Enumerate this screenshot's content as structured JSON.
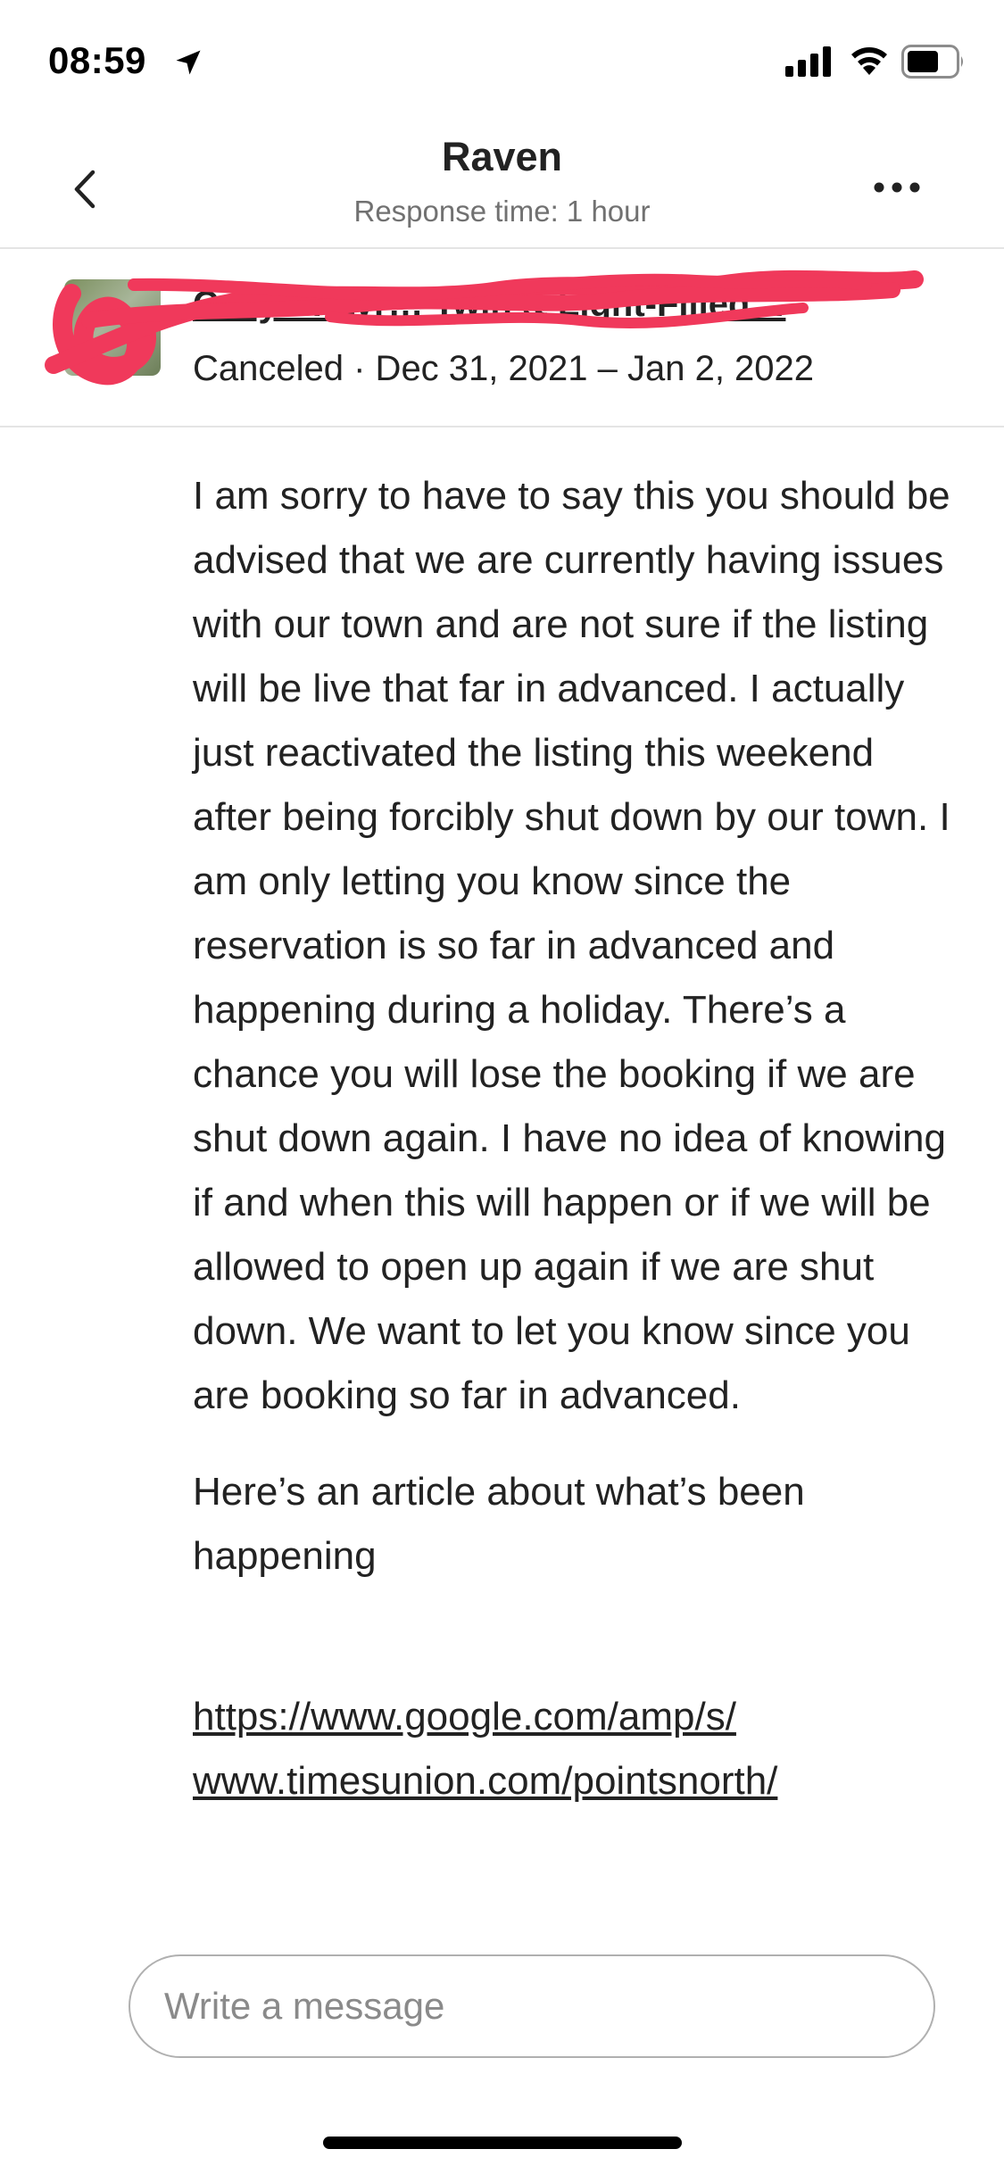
{
  "status_bar": {
    "time": "08:59"
  },
  "header": {
    "title": "Raven",
    "subtitle": "Response time: 1 hour"
  },
  "reservation": {
    "listing_title": "Cozy … Lyr… Twin & Light-Filled…",
    "status": "Canceled · Dec 31, 2021 – Jan 2, 2022"
  },
  "message": {
    "paragraphs": [
      "I am sorry to have to say this you should be advised that we are currently having issues with our town and are not sure if the listing will be live that far in advanced. I actually just reactivated the listing this weekend after being forcibly shut down by our town. I am only letting you know since the reservation is so far in advanced and happening during a holiday. There’s a chance you will lose the booking if we are shut down again. I have no idea of knowing if and when this will happen or if we will be allowed to open up again if we are shut down. We want to let you know since you are booking so far in advanced.",
      "Here’s an article about what’s been happening"
    ],
    "link_line_1": "https://www.google.com/amp/s/",
    "link_line_2": "www.timesunion.com/pointsnorth/"
  },
  "composer": {
    "placeholder": "Write a message"
  },
  "colors": {
    "redaction": "#f0395b",
    "muted_text": "#717171",
    "border": "#b0b0b0"
  }
}
